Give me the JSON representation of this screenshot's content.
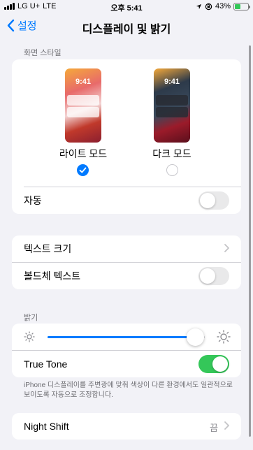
{
  "status_bar": {
    "carrier": "LG U+",
    "network": "LTE",
    "time": "오후 5:41",
    "battery": "43%",
    "battery_level": 0.43
  },
  "nav": {
    "back_label": "설정",
    "title": "디스플레이 및 밝기"
  },
  "appearance": {
    "header": "화면 스타일",
    "light": {
      "label": "라이트 모드",
      "preview_time": "9:41",
      "selected": true
    },
    "dark": {
      "label": "다크 모드",
      "preview_time": "9:41",
      "selected": false
    },
    "auto_label": "자동",
    "auto_on": false
  },
  "text": {
    "size_label": "텍스트 크기",
    "bold_label": "볼드체 텍스트",
    "bold_on": false
  },
  "brightness": {
    "header": "밝기",
    "level": 0.94,
    "true_tone_label": "True Tone",
    "true_tone_on": true,
    "footnote": "iPhone 디스플레이를 주변광에 맞춰 색상이 다른 환경에서도 일관적으로 보이도록 자동으로 조정합니다."
  },
  "night_shift": {
    "label": "Night Shift",
    "value": "끔"
  },
  "colors": {
    "accent": "#007aff",
    "toggle_on": "#34c759",
    "background": "#f2f2f7"
  }
}
